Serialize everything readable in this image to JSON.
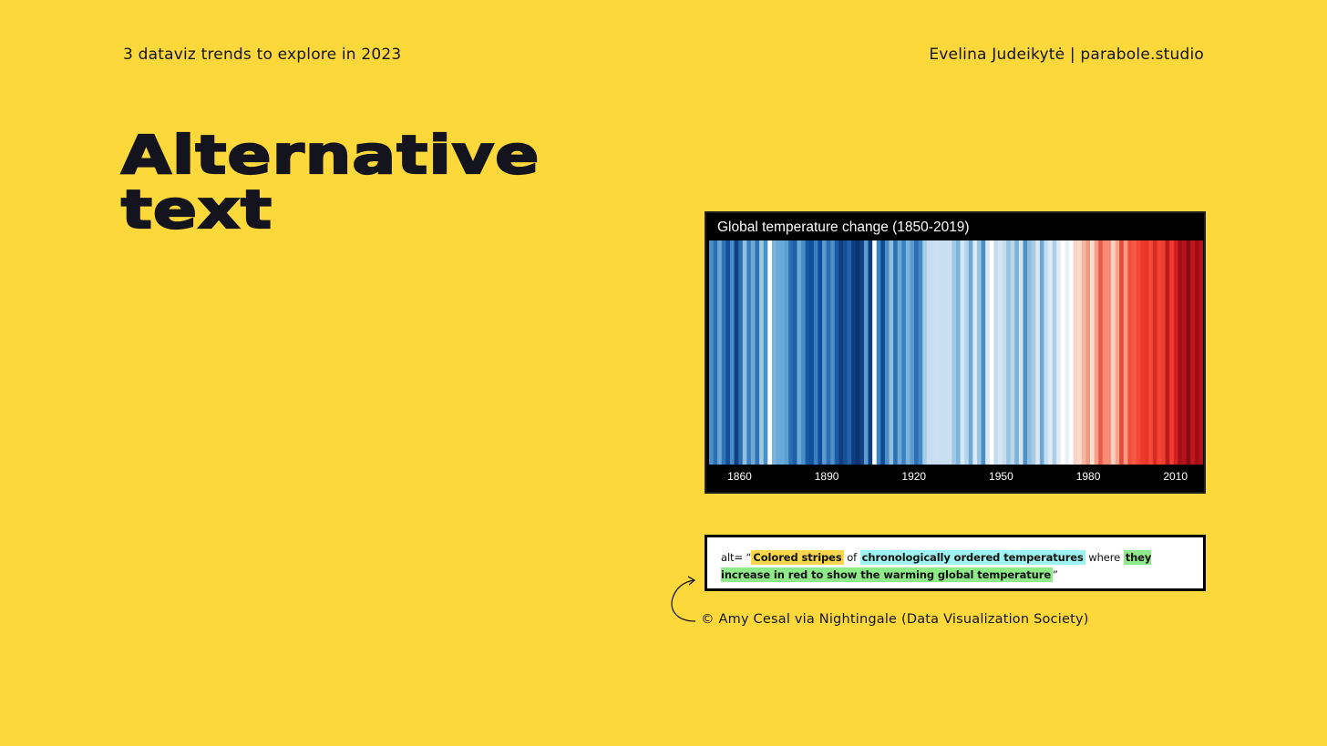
{
  "header": {
    "left": "3 dataviz trends to explore in 2023",
    "right": "Evelina Judeikytė | parabole.studio"
  },
  "title": {
    "line1": "Alternative",
    "line2": "text"
  },
  "chart_data": {
    "type": "heatmap",
    "title": "Global temperature change (1850-2019)",
    "x_range": [
      1850,
      2019
    ],
    "x_ticks": [
      1860,
      1890,
      1920,
      1950,
      1980,
      2010
    ],
    "colors_note": "blue = cooler, red = warmer",
    "stripe_colors": [
      "#4c8fc7",
      "#2b6fb2",
      "#6aa6d6",
      "#2f75b6",
      "#134f97",
      "#4a8dc6",
      "#0e3f82",
      "#2a6eb1",
      "#8fc0e0",
      "#3b80c0",
      "#6ea9d6",
      "#2f74b5",
      "#9ec9e4",
      "#4d90c8",
      "#ffffff",
      "#7db3da",
      "#6aa8d6",
      "#6aa8d6",
      "#5b9fd1",
      "#2a6db0",
      "#1f5fa8",
      "#6aa8d6",
      "#4a8cc6",
      "#1658a0",
      "#0f4e9a",
      "#3a80c0",
      "#0f4c97",
      "#5b9bd0",
      "#2a6db2",
      "#4b8ec8",
      "#1a5aa3",
      "#0e3e80",
      "#174f96",
      "#2563a9",
      "#0b3c7e",
      "#0a3270",
      "#163f82",
      "#5b9cd1",
      "#0c3d80",
      "#ffffff",
      "#3b82c2",
      "#0f4a92",
      "#4b8ec8",
      "#8fc0e0",
      "#2c71b4",
      "#6ea9d6",
      "#3c80c0",
      "#7bb3da",
      "#5a9ad0",
      "#2b6cb0",
      "#4389c5",
      "#a9cfe6",
      "#c7dff0",
      "#c7dff0",
      "#cddff1",
      "#c7dff0",
      "#c7dff0",
      "#cddff1",
      "#9ec8e4",
      "#7db5da",
      "#d8e7f4",
      "#b7d5ec",
      "#6ea9d6",
      "#dce9f5",
      "#9cc6e2",
      "#4a8ec8",
      "#dbe8f4",
      "#ffffff",
      "#c1dbef",
      "#d8e6f3",
      "#c6def0",
      "#99c4e2",
      "#bcd7ec",
      "#7ab2d9",
      "#d3e4f2",
      "#4d90c8",
      "#8fbfe0",
      "#a6cce6",
      "#dbe8f4",
      "#6ea9d6",
      "#c6dff0",
      "#e0ebf6",
      "#a9cee6",
      "#e3ecf6",
      "#ffffff",
      "#ecf1f7",
      "#ffffff",
      "#f6d4c6",
      "#fbd9cb",
      "#f3b7a3",
      "#ef9a82",
      "#fbe0d4",
      "#f7a08a",
      "#e8594a",
      "#ff8b75",
      "#f58d76",
      "#fbd0c1",
      "#f5a48d",
      "#e24a3c",
      "#ff9b85",
      "#f24e3c",
      "#f45b46",
      "#f24a38",
      "#ef3b2c",
      "#e73628",
      "#f44a37",
      "#d92b22",
      "#f24434",
      "#ea3e2e",
      "#bb1a1a",
      "#f03c2c",
      "#d32020",
      "#a50f15",
      "#b5131a",
      "#860b12",
      "#c0181d",
      "#a30e16",
      "#b31218"
    ]
  },
  "alt_text": {
    "prefix": "alt= “",
    "part1": "Colored stripes",
    "join1": " of ",
    "part2": "chronologically ordered temperatures",
    "join2": " where ",
    "part3": "they increase in red to show the warming global temperature",
    "suffix": "”"
  },
  "credit": "© Amy Cesal via Nightingale (Data Visualization Society)"
}
